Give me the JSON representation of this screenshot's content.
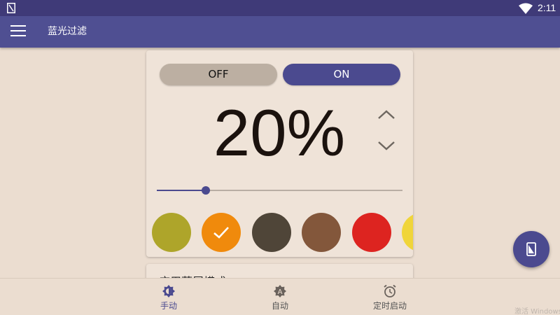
{
  "status_bar": {
    "time": "2:11"
  },
  "app_bar": {
    "title": "蓝光过滤"
  },
  "filter": {
    "off_label": "OFF",
    "on_label": "ON",
    "state": "on",
    "intensity_text": "20%",
    "intensity_value": 0.2
  },
  "colors": {
    "accent": "#4b4a8f",
    "status_bar": "#3f3a78",
    "app_bar": "#4f4f92",
    "background": "#ebddd0"
  },
  "swatches": [
    {
      "color": "#aea52a",
      "selected": false
    },
    {
      "color": "#f08a0c",
      "selected": true
    },
    {
      "color": "#4f4538",
      "selected": false
    },
    {
      "color": "#83573b",
      "selected": false
    },
    {
      "color": "#dd2420",
      "selected": false
    },
    {
      "color": "#f0d53a",
      "selected": false
    }
  ],
  "second_card": {
    "title": "应用蓝屏模式"
  },
  "bottom_nav": [
    {
      "label": "手动",
      "icon": "brightness-icon",
      "active": true
    },
    {
      "label": "自动",
      "icon": "auto-icon",
      "active": false
    },
    {
      "label": "定时启动",
      "icon": "alarm-icon",
      "active": false
    }
  ],
  "watermark": "激活 Windows"
}
